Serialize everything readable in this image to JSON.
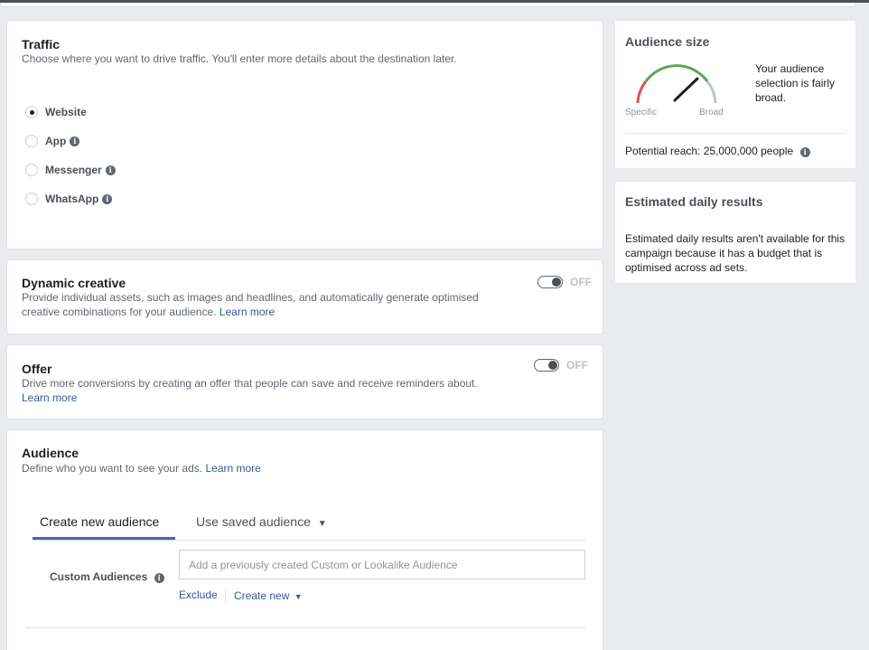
{
  "traffic": {
    "title": "Traffic",
    "description": "Choose where you want to drive traffic. You'll enter more details about the destination later.",
    "options": [
      {
        "label": "Website",
        "selected": true,
        "info": false
      },
      {
        "label": "App",
        "selected": false,
        "info": true
      },
      {
        "label": "Messenger",
        "selected": false,
        "info": true
      },
      {
        "label": "WhatsApp",
        "selected": false,
        "info": true
      }
    ]
  },
  "dynamic_creative": {
    "title": "Dynamic creative",
    "description": "Provide individual assets, such as images and headlines, and automatically generate optimised creative combinations for your audience.",
    "learn_more": "Learn more",
    "toggle_label": "OFF"
  },
  "offer": {
    "title": "Offer",
    "description": "Drive more conversions by creating an offer that people can save and receive reminders about.",
    "learn_more": "Learn more",
    "toggle_label": "OFF"
  },
  "audience": {
    "title": "Audience",
    "description": "Define who you want to see your ads.",
    "learn_more": "Learn more",
    "tabs": [
      {
        "label": "Create new audience",
        "active": true
      },
      {
        "label": "Use saved audience",
        "active": false
      }
    ],
    "custom_audiences_label": "Custom Audiences",
    "custom_audiences_placeholder": "Add a previously created Custom or Lookalike Audience",
    "exclude_label": "Exclude",
    "create_new_label": "Create new"
  },
  "audience_size": {
    "title": "Audience size",
    "gauge_specific": "Specific",
    "gauge_broad": "Broad",
    "summary": "Your audience selection is fairly broad.",
    "potential_reach": "Potential reach: 25,000,000 people",
    "colors": {
      "specific": "#d9534f",
      "middle": "#5aa55a",
      "broad": "#bec2c9"
    }
  },
  "estimated_daily": {
    "title": "Estimated daily results",
    "message": "Estimated daily results aren't available for this campaign because it has a budget that is optimised across ad sets."
  },
  "icons": {
    "info": "info-icon",
    "caret": "caret-down-icon",
    "needle": "gauge-needle"
  },
  "accent_color": "#4267b2"
}
